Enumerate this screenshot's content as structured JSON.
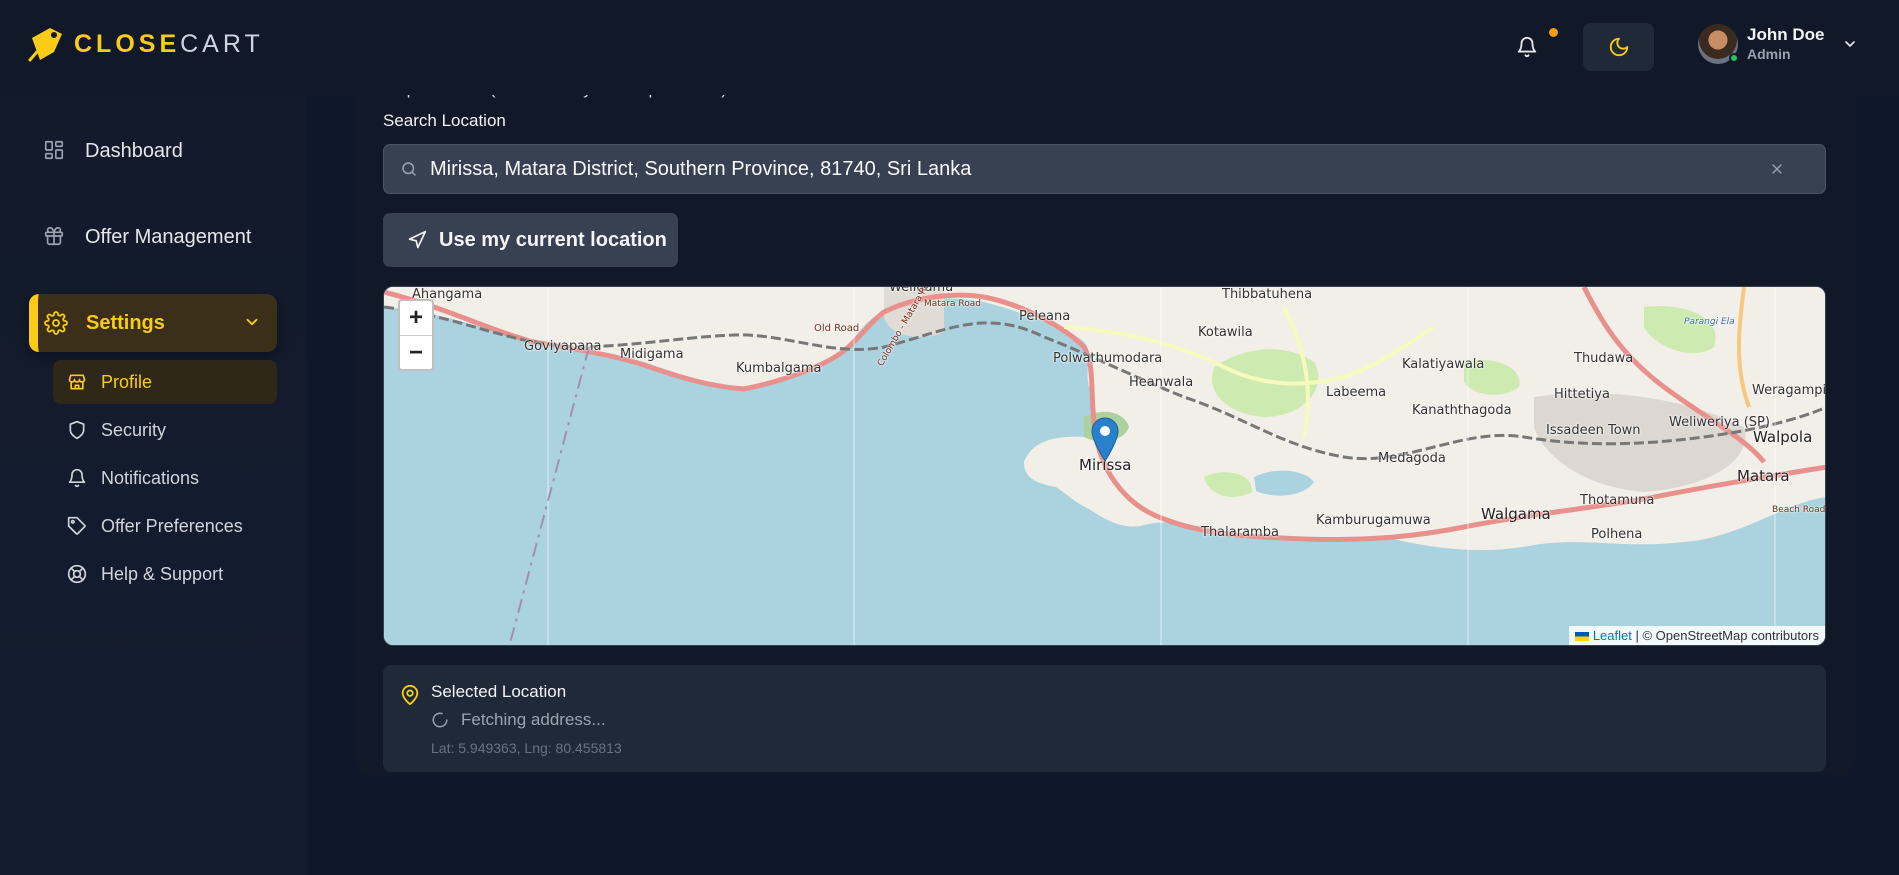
{
  "app": {
    "logo_close": "CLOSE",
    "logo_cart": "CART"
  },
  "header": {
    "user_name": "John Doe",
    "user_role": "Admin"
  },
  "sidebar": {
    "items": [
      {
        "label": "Dashboard",
        "icon": "grid-icon"
      },
      {
        "label": "Offer Management",
        "icon": "gift-icon"
      },
      {
        "label": "Settings",
        "icon": "gear-icon",
        "active": true
      }
    ],
    "subitems": [
      {
        "label": "Profile",
        "icon": "store-icon",
        "active": true
      },
      {
        "label": "Security",
        "icon": "shield-icon"
      },
      {
        "label": "Notifications",
        "icon": "bell-icon"
      },
      {
        "label": "Offer Preferences",
        "icon": "tag-icon"
      },
      {
        "label": "Help & Support",
        "icon": "lifebuoy-icon"
      }
    ]
  },
  "main": {
    "map_label": "Map Location (Click to set your shop location)",
    "search_label": "Search Location",
    "search_value": "Mirissa, Matara District, Southern Province, 81740, Sri Lanka",
    "use_location_label": "Use my current location",
    "map": {
      "places": [
        "Ahangama",
        "Goviyapana",
        "Midigama",
        "Kumbalgama",
        "Weligama",
        "Old Road",
        "Colombo - Matara Road",
        "Matara Road",
        "Peleana",
        "Thibbatuhena",
        "Kotawila",
        "Polwathumodara",
        "Heanwala",
        "Kalatiyawala",
        "Thudawa",
        "Weragampita",
        "Labeema",
        "Hittetiya",
        "Kanaththagoda",
        "Issadeen Town",
        "Weliweriya (SP)",
        "Walpola",
        "Mirissa",
        "Medagoda",
        "Matara",
        "Thotamuna",
        "Walgama",
        "Thalaramba",
        "Kamburugamuwa",
        "Polhena",
        "Beach Road",
        "Parangi Ela"
      ],
      "zoom_in": "+",
      "zoom_out": "−",
      "attribution_link": "Leaflet",
      "attribution_text": "| © OpenStreetMap contributors"
    },
    "selected": {
      "title": "Selected Location",
      "status": "Fetching address...",
      "coords": "Lat: 5.949363, Lng: 80.455813"
    }
  },
  "colors": {
    "accent": "#facc15",
    "background": "#0f172a",
    "panel": "#111827"
  }
}
